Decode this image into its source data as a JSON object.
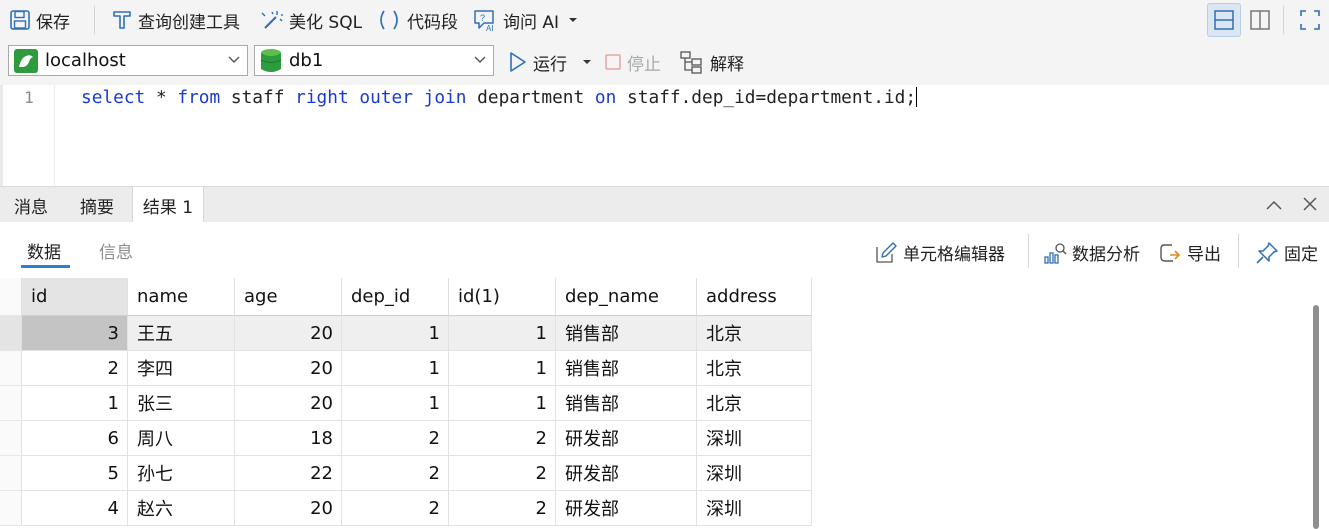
{
  "toolbar": {
    "save_label": "保存",
    "query_builder_label": "查询创建工具",
    "beautify_label": "美化 SQL",
    "snippet_label": "代码段",
    "ask_ai_label": "询问 AI"
  },
  "connection": {
    "server": "localhost",
    "database": "db1",
    "run_label": "运行",
    "stop_label": "停止",
    "explain_label": "解释"
  },
  "editor": {
    "line_number": "1",
    "sql": {
      "kw_select": "select",
      "star": " * ",
      "kw_from": "from",
      "t_staff": " staff ",
      "kw_right": "right",
      "sp1": " ",
      "kw_outer": "outer",
      "sp2": " ",
      "kw_join": "join",
      "t_department": " department ",
      "kw_on": "on",
      "t_condition": " staff.dep_id=department.id;"
    }
  },
  "result_tabs": {
    "messages": "消息",
    "summary": "摘要",
    "result1": "结果 1"
  },
  "subtabs": {
    "data": "数据",
    "info": "信息"
  },
  "result_actions": {
    "cell_editor": "单元格编辑器",
    "data_analysis": "数据分析",
    "export": "导出",
    "pin": "固定"
  },
  "grid": {
    "columns": [
      "id",
      "name",
      "age",
      "dep_id",
      "id(1)",
      "dep_name",
      "address"
    ],
    "rows": [
      [
        "3",
        "王五",
        "20",
        "1",
        "1",
        "销售部",
        "北京"
      ],
      [
        "2",
        "李四",
        "20",
        "1",
        "1",
        "销售部",
        "北京"
      ],
      [
        "1",
        "张三",
        "20",
        "1",
        "1",
        "销售部",
        "北京"
      ],
      [
        "6",
        "周八",
        "18",
        "2",
        "2",
        "研发部",
        "深圳"
      ],
      [
        "5",
        "孙七",
        "22",
        "2",
        "2",
        "研发部",
        "深圳"
      ],
      [
        "4",
        "赵六",
        "20",
        "2",
        "2",
        "研发部",
        "深圳"
      ]
    ]
  },
  "colors": {
    "keyword": "#1a3bd1",
    "accent": "#2f7fd0",
    "db_icon": "#3c9a3c"
  }
}
